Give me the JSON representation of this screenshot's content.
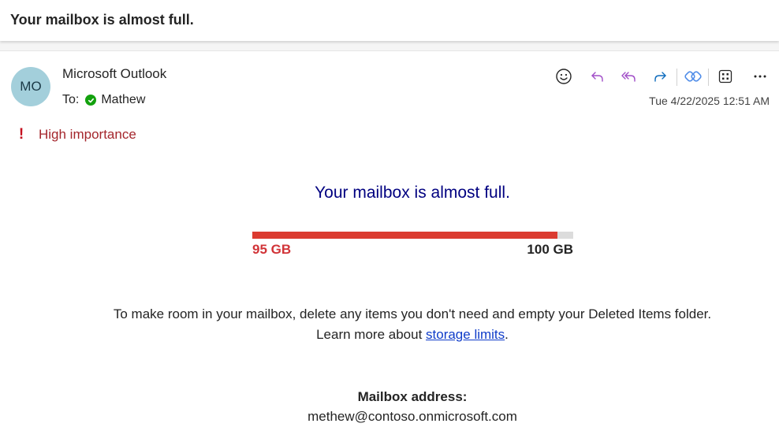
{
  "subject": "Your mailbox is almost full.",
  "sender": {
    "initials": "MO",
    "name": "Microsoft Outlook",
    "to_label": "To:",
    "recipient": "Mathew",
    "timestamp": "Tue 4/22/2025 12:51 AM",
    "avatar_color": "#a3cfdb"
  },
  "toolbar": {
    "icons": [
      "emoji-icon",
      "reply-icon",
      "reply-all-icon",
      "forward-icon",
      "copilot-icon",
      "apps-icon",
      "more-options-icon"
    ],
    "accent_purple": "#a04cc7",
    "accent_blue": "#0f6cbd"
  },
  "importance": {
    "label": "High importance",
    "icon": "exclamation-icon",
    "color": "#a4262c"
  },
  "body": {
    "heading": "Your mailbox is almost full.",
    "quota": {
      "used_label": "95 GB",
      "total_label": "100 GB",
      "used_fraction": 0.95,
      "bar_color": "#db3b30"
    },
    "instruction": "To make room in your mailbox, delete any items you don't need and empty your Deleted Items folder.",
    "learn_more_prefix": "Learn more about ",
    "learn_more_link": "storage limits",
    "learn_more_suffix": ".",
    "address_label": "Mailbox address:",
    "address_value": "methew@contoso.onmicrosoft.com"
  }
}
